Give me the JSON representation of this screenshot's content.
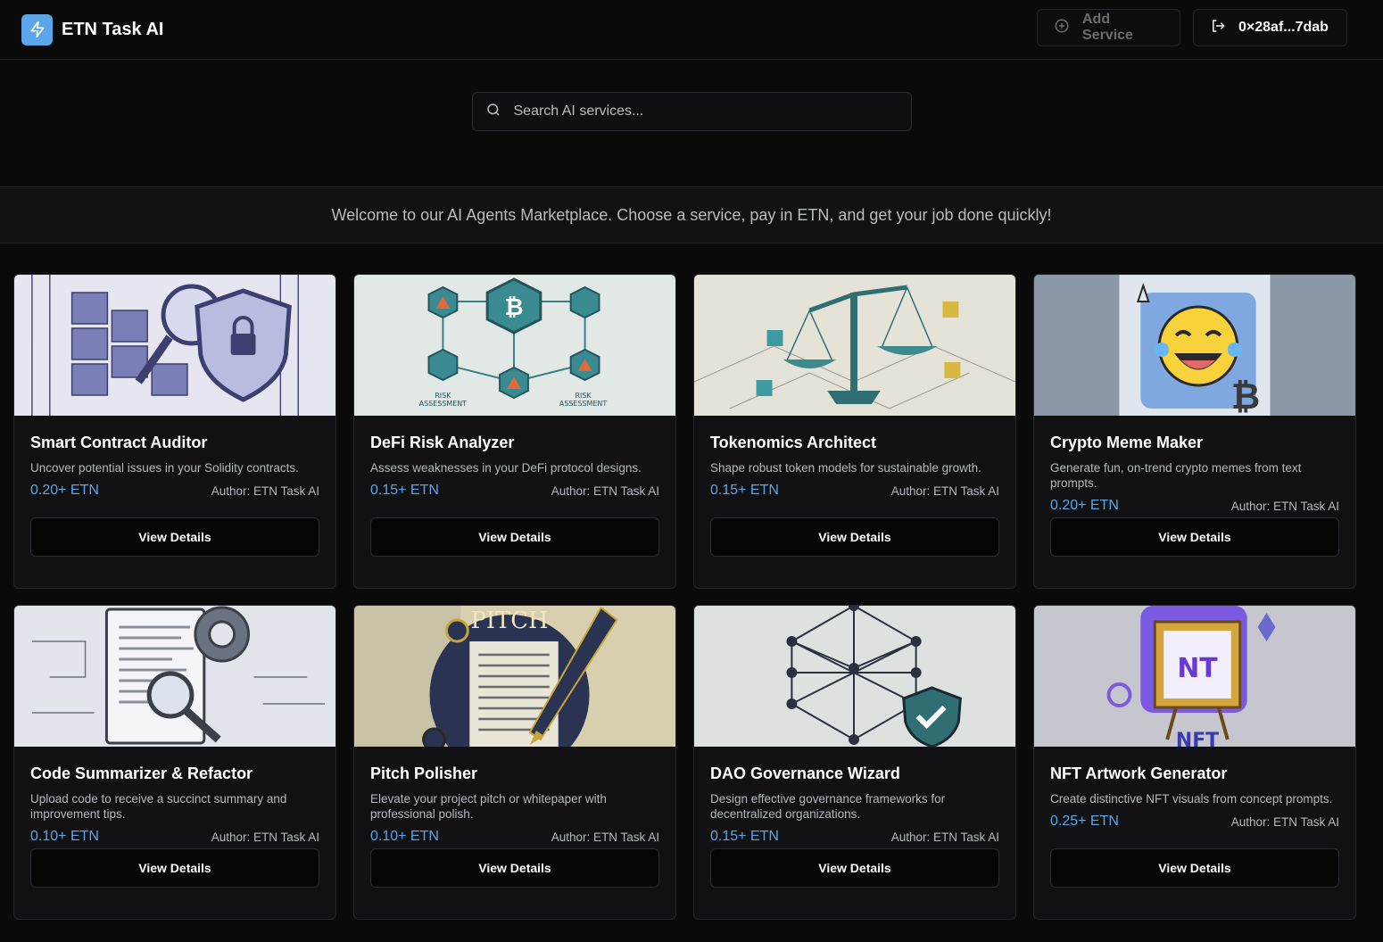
{
  "app": {
    "name": "ETN Task AI"
  },
  "header": {
    "add_service_label": "Add Service",
    "wallet_label": "0×28af...7dab"
  },
  "search": {
    "placeholder": "Search AI services..."
  },
  "welcome_text": "Welcome to our AI Agents Marketplace. Choose a service, pay in ETN, and get your job done quickly!",
  "colors": {
    "accent": "#5aa6e8",
    "background": "#0a0a0b",
    "card": "#111113"
  },
  "services": [
    {
      "title": "Smart Contract Auditor",
      "description": "Uncover potential issues in your Solidity contracts.",
      "price": "0.20+ ETN",
      "author": "Author: ETN Task AI",
      "button": "View Details",
      "image_icon": "shield-lock-icon"
    },
    {
      "title": "DeFi Risk Analyzer",
      "description": "Assess weaknesses in your DeFi protocol designs.",
      "price": "0.15+ ETN",
      "author": "Author: ETN Task AI",
      "button": "View Details",
      "image_icon": "bitcoin-network-icon"
    },
    {
      "title": "Tokenomics Architect",
      "description": "Shape robust token models for sustainable growth.",
      "price": "0.15+ ETN",
      "author": "Author: ETN Task AI",
      "button": "View Details",
      "image_icon": "balance-scale-icon"
    },
    {
      "title": "Crypto Meme Maker",
      "description": "Generate fun, on-trend crypto memes from text prompts.",
      "price": "0.20+ ETN",
      "author": "Author: ETN Task AI",
      "button": "View Details",
      "image_icon": "laughing-emoji-icon"
    },
    {
      "title": "Code Summarizer & Refactor",
      "description": "Upload code to receive a succinct summary and improvement tips.",
      "price": "0.10+ ETN",
      "author": "Author: ETN Task AI",
      "button": "View Details",
      "image_icon": "document-gear-icon"
    },
    {
      "title": "Pitch Polisher",
      "description": "Elevate your project pitch or whitepaper with professional polish.",
      "price": "0.10+ ETN",
      "author": "Author: ETN Task AI",
      "button": "View Details",
      "image_icon": "fountain-pen-icon"
    },
    {
      "title": "DAO Governance Wizard",
      "description": "Design effective governance frameworks for decentralized organizations.",
      "price": "0.15+ ETN",
      "author": "Author: ETN Task AI",
      "button": "View Details",
      "image_icon": "network-shield-icon"
    },
    {
      "title": "NFT Artwork Generator",
      "description": "Create distinctive NFT visuals from concept prompts.",
      "price": "0.25+ ETN",
      "author": "Author: ETN Task AI",
      "button": "View Details",
      "image_icon": "nft-easel-icon"
    }
  ]
}
